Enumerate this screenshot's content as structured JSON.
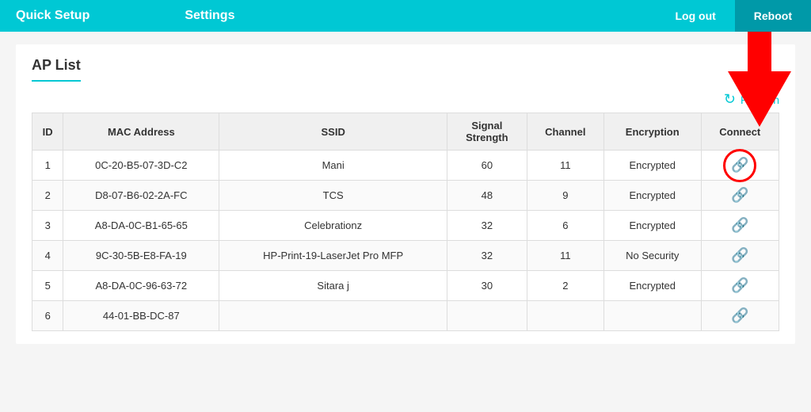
{
  "navbar": {
    "items": [
      {
        "label": "Quick Setup",
        "id": "quick-setup"
      },
      {
        "label": "Settings",
        "id": "settings"
      }
    ],
    "right": [
      {
        "label": "Log out",
        "id": "logout"
      },
      {
        "label": "Reboot",
        "id": "reboot",
        "highlight": true
      }
    ]
  },
  "page": {
    "title": "AP List"
  },
  "toolbar": {
    "refresh_label": "Refresh"
  },
  "table": {
    "headers": [
      "ID",
      "MAC Address",
      "SSID",
      "Signal Strength",
      "Channel",
      "Encryption",
      "Connect"
    ],
    "rows": [
      {
        "id": 1,
        "mac": "0C-20-B5-07-3D-C2",
        "ssid": "Mani",
        "signal": 60,
        "channel": 11,
        "encryption": "Encrypted",
        "circled": true
      },
      {
        "id": 2,
        "mac": "D8-07-B6-02-2A-FC",
        "ssid": "TCS",
        "signal": 48,
        "channel": 9,
        "encryption": "Encrypted",
        "circled": false
      },
      {
        "id": 3,
        "mac": "A8-DA-0C-B1-65-65",
        "ssid": "Celebrationz",
        "signal": 32,
        "channel": 6,
        "encryption": "Encrypted",
        "circled": false
      },
      {
        "id": 4,
        "mac": "9C-30-5B-E8-FA-19",
        "ssid": "HP-Print-19-LaserJet Pro MFP",
        "signal": 32,
        "channel": 11,
        "encryption": "No Security",
        "circled": false
      },
      {
        "id": 5,
        "mac": "A8-DA-0C-96-63-72",
        "ssid": "Sitara j",
        "signal": 30,
        "channel": 2,
        "encryption": "Encrypted",
        "circled": false
      },
      {
        "id": 6,
        "mac": "44-01-BB-DC-87",
        "ssid": "",
        "signal": "",
        "channel": "",
        "encryption": "",
        "circled": false
      }
    ]
  }
}
